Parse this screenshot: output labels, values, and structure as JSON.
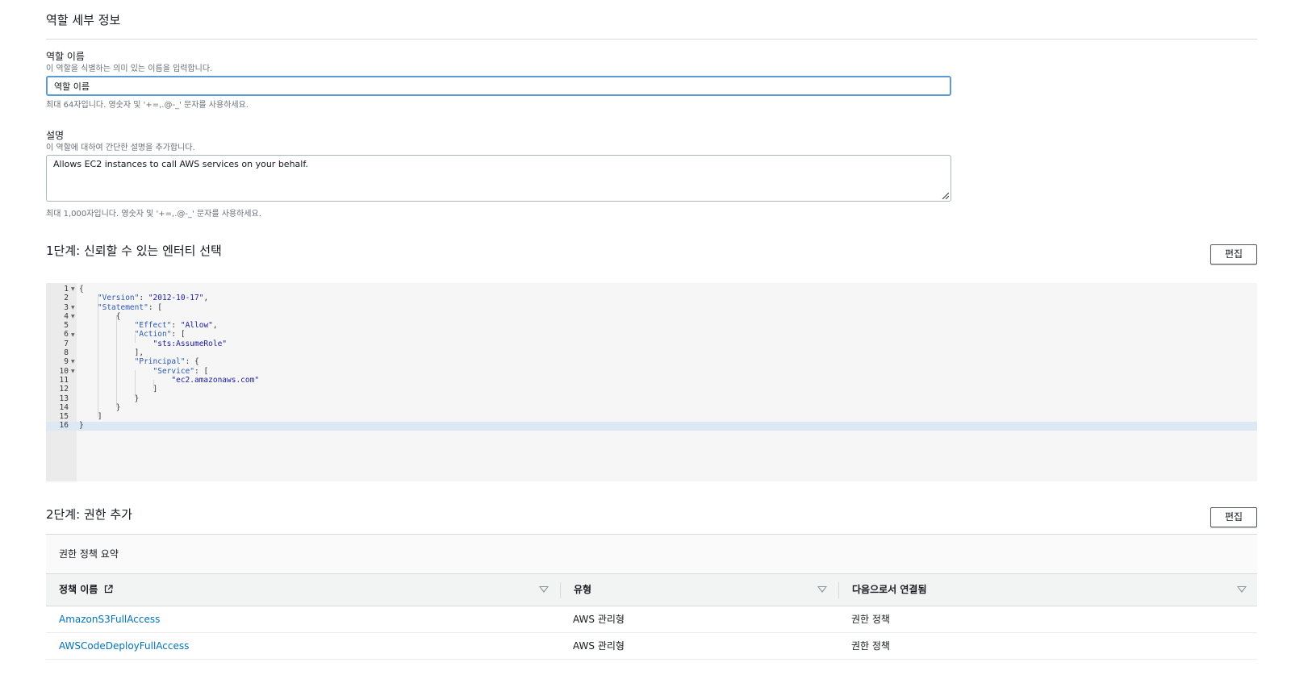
{
  "details": {
    "title": "역할 세부 정보",
    "role_name": {
      "label": "역할 이름",
      "description": "이 역할을 식별하는 의미 있는 이름을 입력합니다.",
      "value": "역할 이름",
      "hint": "최대 64자입니다. 영숫자 및 '+=,.@-_' 문자를 사용하세요."
    },
    "role_desc": {
      "label": "설명",
      "description": "이 역할에 대하여 간단한 설명을 추가합니다.",
      "value": "Allows EC2 instances to call AWS services on your behalf.",
      "hint": "최대 1,000자입니다. 영숫자 및 '+=,.@-_' 문자를 사용하세요."
    }
  },
  "step1": {
    "title": "1단계: 신뢰할 수 있는 엔터티 선택",
    "edit_label": "편집",
    "line_numbers": [
      "1",
      "2",
      "3",
      "4",
      "5",
      "6",
      "7",
      "8",
      "9",
      "10",
      "11",
      "12",
      "13",
      "14",
      "15",
      "16"
    ],
    "code_lines": [
      "{",
      "    \"Version\": \"2012-10-17\",",
      "    \"Statement\": [",
      "        {",
      "            \"Effect\": \"Allow\",",
      "            \"Action\": [",
      "                \"sts:AssumeRole\"",
      "            ],",
      "            \"Principal\": {",
      "                \"Service\": [",
      "                    \"ec2.amazonaws.com\"",
      "                ]",
      "            }",
      "        }",
      "    ]",
      "}"
    ]
  },
  "step2": {
    "title": "2단계: 권한 추가",
    "edit_label": "편집",
    "summary_title": "권한 정책 요약",
    "columns": [
      "정책 이름",
      "유형",
      "다음으로서 연결됨"
    ],
    "rows": [
      {
        "name": "AmazonS3FullAccess",
        "type": "AWS 관리형",
        "attached_as": "권한 정책"
      },
      {
        "name": "AWSCodeDeployFullAccess",
        "type": "AWS 관리형",
        "attached_as": "권한 정책"
      }
    ]
  },
  "colors": {
    "link": "#0073bb",
    "focus_border": "#5b9bd5",
    "active_line": "#dce9f5"
  }
}
